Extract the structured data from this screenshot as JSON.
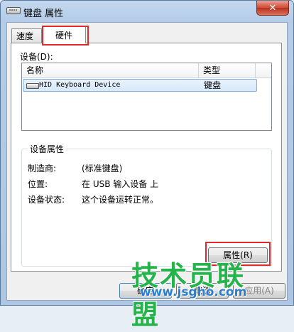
{
  "window": {
    "title": "键盘 属性",
    "close_glyph": "✕"
  },
  "tabs": [
    {
      "label": "速度",
      "selected": false
    },
    {
      "label": "硬件",
      "selected": true
    }
  ],
  "devices": {
    "label": "设备(D):",
    "columns": [
      "名称",
      "类型"
    ],
    "rows": [
      {
        "name": "HID Keyboard Device",
        "type": "键盘",
        "icon": "keyboard-icon",
        "selected": true
      }
    ]
  },
  "device_properties": {
    "title": "设备属性",
    "manufacturer_label": "制造商:",
    "manufacturer_value": "(标准键盘)",
    "location_label": "位置:",
    "location_value": "在 USB 输入设备 上",
    "status_label": "设备状态:",
    "status_value": "这个设备运转正常。",
    "properties_button": "属性(R)"
  },
  "buttons": {
    "ok": "确定",
    "cancel": "取消",
    "apply": "应用(A)"
  },
  "watermark": {
    "text": "技术员联盟",
    "url": "www.jsgho.com"
  },
  "colors": {
    "highlight": "#e02a2a",
    "selection": "#d6e8fa",
    "watermark_green": "#25b34b",
    "watermark_blue": "#2a7fd0"
  }
}
